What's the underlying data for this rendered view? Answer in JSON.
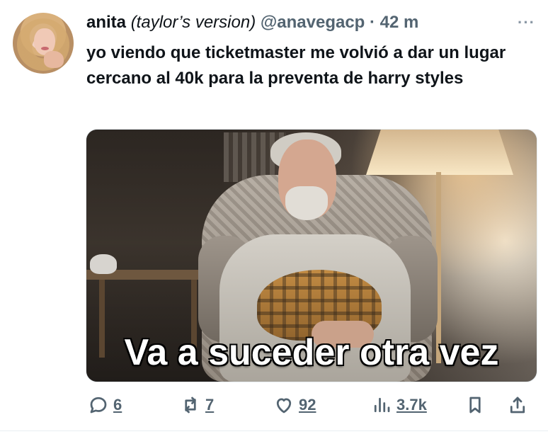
{
  "tweet": {
    "author": {
      "name": "anita",
      "name_suffix": "(taylor’s version)",
      "handle": "@anavegacp",
      "separator": "·",
      "time": "42 m",
      "avatar_icon": "profile-photo"
    },
    "more_icon": "more-options-icon",
    "more_label": "···",
    "text": "yo viendo que ticketmaster me volvió a dar un lugar cercano al 40k para la preventa de harry styles",
    "media": {
      "caption": "Va a suceder otra vez",
      "description_icon": "meme-image"
    },
    "actions": {
      "reply": {
        "icon": "reply-icon",
        "count": "6"
      },
      "retweet": {
        "icon": "retweet-icon",
        "count": "7"
      },
      "like": {
        "icon": "heart-icon",
        "count": "92"
      },
      "views": {
        "icon": "analytics-icon",
        "count": "3.7k"
      },
      "bookmark": {
        "icon": "bookmark-icon"
      },
      "share": {
        "icon": "share-icon"
      }
    }
  },
  "colors": {
    "text": "#0f1419",
    "muted": "#536471",
    "background": "#ffffff"
  }
}
